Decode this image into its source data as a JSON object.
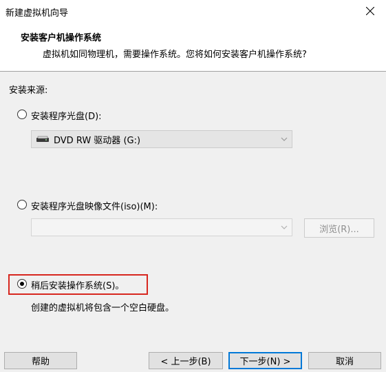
{
  "window": {
    "title": "新建虚拟机向导"
  },
  "header": {
    "title": "安装客户机操作系统",
    "subtitle": "虚拟机如同物理机，需要操作系统。您将如何安装客户机操作系统?"
  },
  "source_label": "安装来源:",
  "options": {
    "disc": {
      "label": "安装程序光盘(D):",
      "selected": false,
      "drive_value": "DVD RW 驱动器 (G:)"
    },
    "iso": {
      "label": "安装程序光盘映像文件(iso)(M):",
      "selected": false,
      "path_value": "",
      "browse_label": "浏览(R)..."
    },
    "later": {
      "label": "稍后安装操作系统(S)。",
      "selected": true,
      "description": "创建的虚拟机将包含一个空白硬盘。"
    }
  },
  "buttons": {
    "help": "帮助",
    "back": "< 上一步(B)",
    "next": "下一步(N) >",
    "cancel": "取消"
  },
  "colors": {
    "highlight": "#d7261e",
    "focus": "#0078d7"
  }
}
